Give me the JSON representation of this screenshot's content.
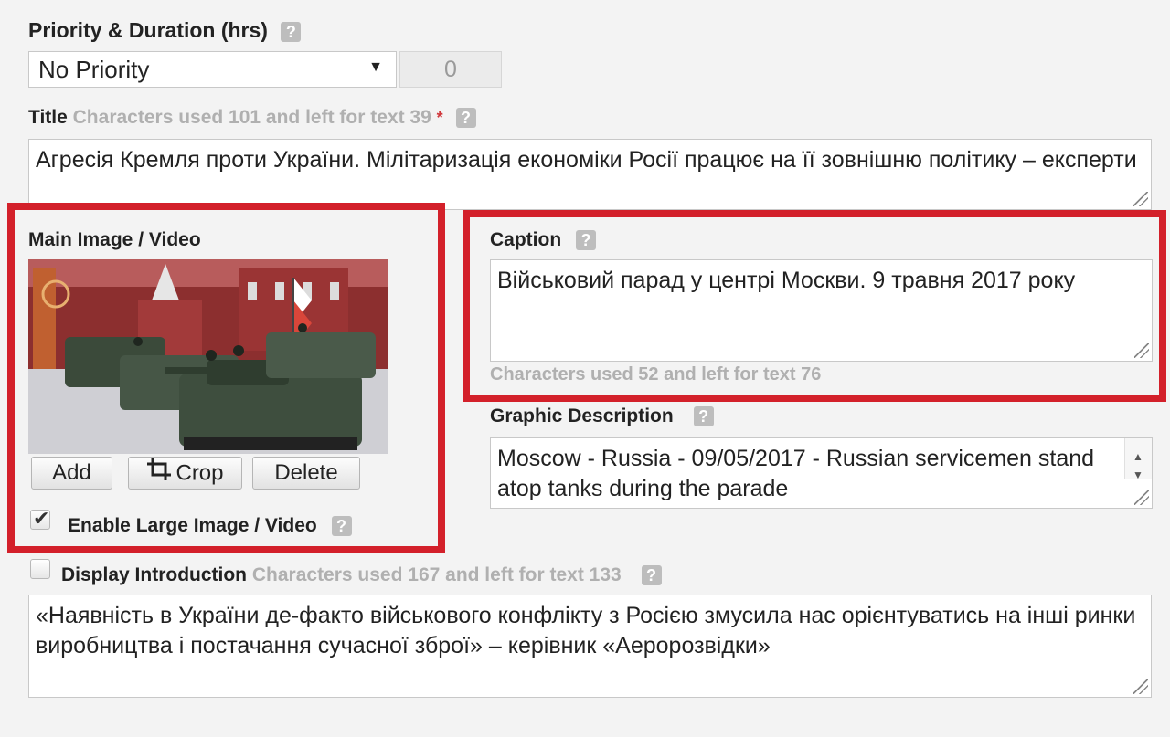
{
  "priority": {
    "label": "Priority & Duration (hrs)",
    "help": "?",
    "select_value": "No Priority",
    "duration_value": "0"
  },
  "title": {
    "label": "Title",
    "counter": "Characters used 101 and left for text 39",
    "required_mark": "*",
    "help": "?",
    "value": "Агресія Кремля проти України. Мілітаризація економіки Росії працює на її зовнішню політику – експерти"
  },
  "main_image": {
    "label": "Main Image / Video",
    "add_label": "Add",
    "crop_label": "Crop",
    "delete_label": "Delete",
    "enable_large_label": "Enable Large Image / Video",
    "enable_large_checked": true,
    "help": "?"
  },
  "caption": {
    "label": "Caption",
    "help": "?",
    "value": "Військовий парад у центрі Москви. 9 травня 2017 року",
    "counter": "Characters used 52 and left for text 76"
  },
  "graphic_description": {
    "label": "Graphic Description",
    "help": "?",
    "value": "Moscow - Russia - 09/05/2017 - Russian servicemen stand atop tanks during the parade"
  },
  "introduction": {
    "label": "Display Introduction",
    "counter": "Characters used 167 and left for text 133",
    "help": "?",
    "checked": false,
    "value": "«Наявність в України де-факто військового конфлікту з Росією змусила нас орієнтуватись на інші ринки виробництва і постачання сучасної зброї» – керівник «Аеророзвідки»"
  },
  "colors": {
    "highlight_frame": "#d3202a",
    "background": "#f3f3f3",
    "counter_text": "#b0b0b0"
  }
}
